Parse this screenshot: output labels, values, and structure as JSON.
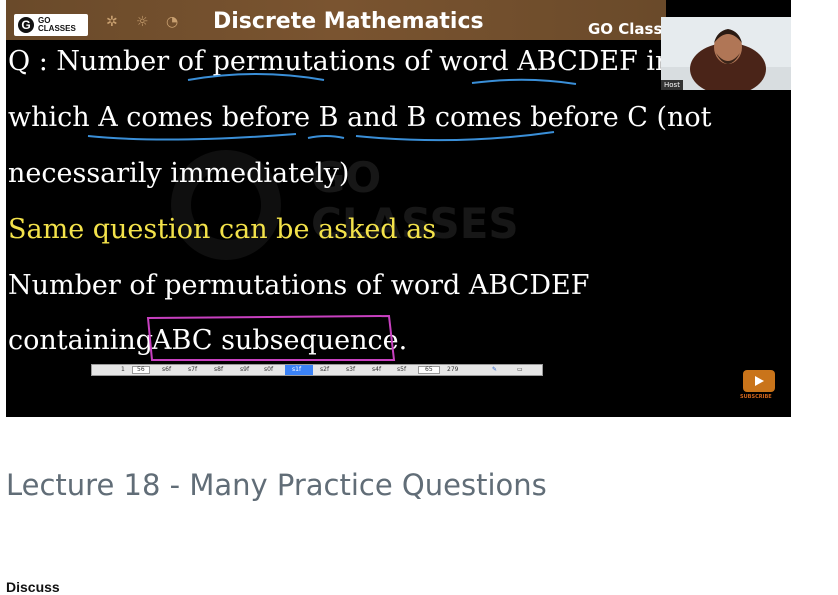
{
  "video": {
    "banner": {
      "logo_line1": "GO",
      "logo_line2": "CLASSES",
      "title": "Discrete Mathematics",
      "right_text": "GO Classe"
    },
    "watermark_line1": "GO",
    "watermark_line2": "CLASSES",
    "lines": [
      "Q : Number of permutations of  word  ABCDEF in",
      "which A comes before B and B comes before C (not",
      "necessarily immediately)",
      "Same question can be asked as",
      "Number of permutations of  word  ABCDEF",
      "containing",
      "ABC subsequence."
    ],
    "webcam_label": "Host",
    "toolbar": {
      "page": "1",
      "zoom": "56",
      "items": [
        "s6f",
        "s7f",
        "s8f",
        "s9f",
        "s0f",
        "s1f",
        "s2f",
        "s3f",
        "s4f",
        "s5f"
      ],
      "page_num": "65",
      "page_total": "279"
    },
    "subscribe_label": "SUBSCRIBE"
  },
  "lecture": {
    "title": "Lecture 18 - Many Practice Questions"
  },
  "discuss_label": "Discuss",
  "colors": {
    "yellow_text": "#f3e24a",
    "annotation_blue": "#3a8fd8",
    "box_magenta": "#c840c0",
    "title_gray": "#616d77"
  }
}
